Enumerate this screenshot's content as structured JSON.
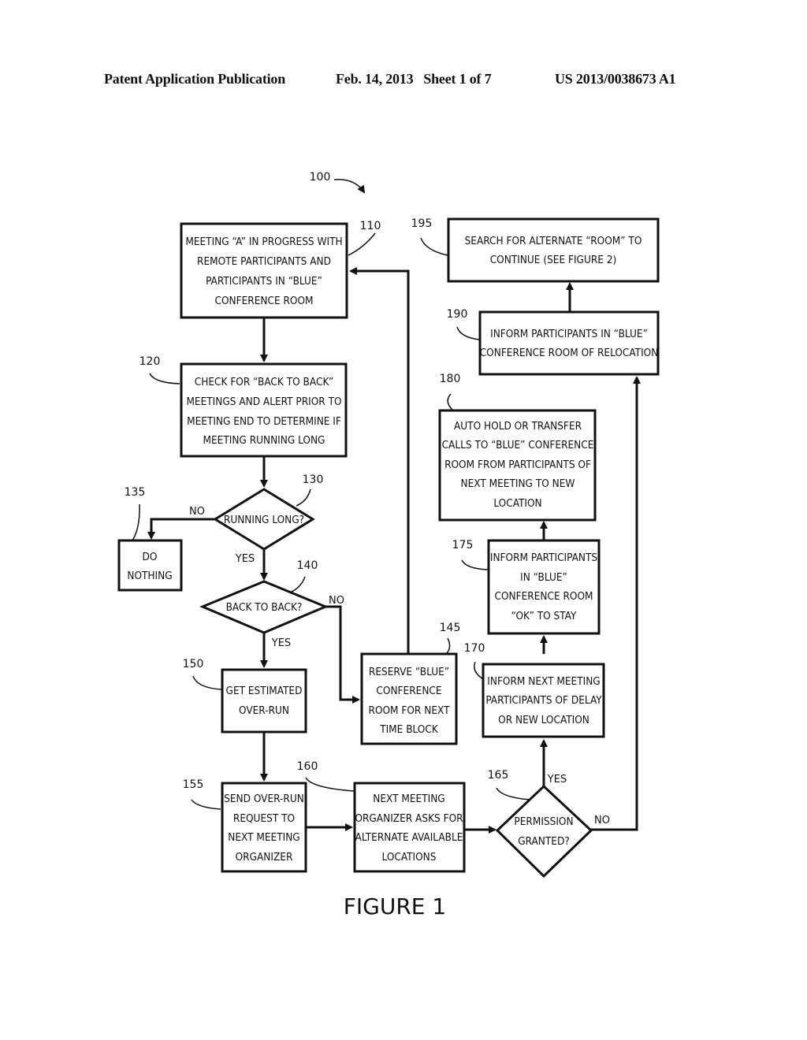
{
  "header": {
    "publication": "Patent Application Publication",
    "date_sheet": "Feb. 14, 2013   Sheet 1 of 7",
    "number": "US 2013/0038673 A1"
  },
  "diagram": {
    "ref_main": "100",
    "figure_label": "FIGURE 1",
    "nodes": {
      "n110": {
        "ref": "110",
        "lines": [
          "MEETING “A” IN PROGRESS WITH",
          "REMOTE PARTICIPANTS AND",
          "PARTICIPANTS IN “BLUE”",
          "CONFERENCE ROOM"
        ]
      },
      "n120": {
        "ref": "120",
        "lines": [
          "CHECK FOR “BACK TO BACK”",
          "MEETINGS AND ALERT PRIOR TO",
          "MEETING END TO DETERMINE IF",
          "MEETING RUNNING LONG"
        ]
      },
      "n130": {
        "ref": "130",
        "lines": [
          "RUNNING LONG?"
        ]
      },
      "n135": {
        "ref": "135",
        "lines": [
          "DO",
          "NOTHING"
        ]
      },
      "n140": {
        "ref": "140",
        "lines": [
          "BACK TO BACK?"
        ]
      },
      "n145": {
        "ref": "145",
        "lines": [
          "RESERVE “BLUE”",
          "CONFERENCE",
          "ROOM FOR NEXT",
          "TIME BLOCK"
        ]
      },
      "n150": {
        "ref": "150",
        "lines": [
          "GET ESTIMATED",
          "OVER-RUN"
        ]
      },
      "n155": {
        "ref": "155",
        "lines": [
          "SEND OVER-RUN",
          "REQUEST TO",
          "NEXT MEETING",
          "ORGANIZER"
        ]
      },
      "n160": {
        "ref": "160",
        "lines": [
          "NEXT MEETING",
          "ORGANIZER ASKS FOR",
          "ALTERNATE AVAILABLE",
          "LOCATIONS"
        ]
      },
      "n165": {
        "ref": "165",
        "lines": [
          "PERMISSION",
          "GRANTED?"
        ]
      },
      "n170": {
        "ref": "170",
        "lines": [
          "INFORM NEXT MEETING",
          "PARTICIPANTS OF DELAY",
          "OR NEW LOCATION"
        ]
      },
      "n175": {
        "ref": "175",
        "lines": [
          "INFORM PARTICIPANTS",
          "IN “BLUE”",
          "CONFERENCE ROOM",
          "“OK” TO STAY"
        ]
      },
      "n180": {
        "ref": "180",
        "lines": [
          "AUTO HOLD OR TRANSFER",
          "CALLS TO “BLUE” CONFERENCE",
          "ROOM FROM PARTICIPANTS OF",
          "NEXT MEETING TO NEW",
          "LOCATION"
        ]
      },
      "n190": {
        "ref": "190",
        "lines": [
          "INFORM PARTICIPANTS IN “BLUE”",
          "CONFERENCE ROOM OF RELOCATION"
        ]
      },
      "n195": {
        "ref": "195",
        "lines": [
          "SEARCH FOR ALTERNATE “ROOM” TO",
          "CONTINUE (SEE FIGURE 2)"
        ]
      }
    },
    "edge_labels": {
      "no_130": "NO",
      "yes_130": "YES",
      "no_140": "NO",
      "yes_140": "YES",
      "yes_165": "YES",
      "no_165": "NO"
    }
  }
}
